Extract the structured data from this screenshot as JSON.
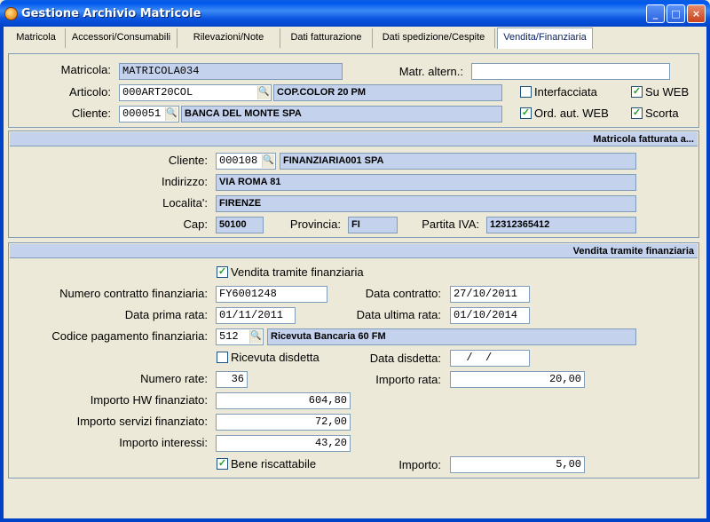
{
  "window": {
    "title": "Gestione Archivio Matricole",
    "min": "_",
    "max": "□",
    "close": "×"
  },
  "tabs": [
    "Matricola",
    "Accessori/Consumabili",
    "Rilevazioni/Note",
    "Dati fatturazione",
    "Dati spedizione/Cespite",
    "Vendita/Finanziaria"
  ],
  "top": {
    "matricola_label": "Matricola:",
    "matricola": "MATRICOLA034",
    "matr_altern_label": "Matr. altern.:",
    "matr_altern": "",
    "articolo_label": "Articolo:",
    "articolo_code": "000ART20COL",
    "articolo_desc": "COP.COLOR 20 PM",
    "cliente_label": "Cliente:",
    "cliente_code": "000051",
    "cliente_desc": "BANCA DEL MONTE SPA",
    "interfacciata_label": "Interfacciata",
    "interfacciata": false,
    "su_web_label": "Su WEB",
    "su_web": true,
    "ord_aut_web_label": "Ord. aut. WEB",
    "ord_aut_web": true,
    "scorta_label": "Scorta",
    "scorta": true
  },
  "fatturata": {
    "header": "Matricola fatturata a...",
    "cliente_label": "Cliente:",
    "cliente_code": "000108",
    "cliente_desc": "FINANZIARIA001 SPA",
    "indirizzo_label": "Indirizzo:",
    "indirizzo": "VIA ROMA 81",
    "localita_label": "Localita':",
    "localita": "FIRENZE",
    "cap_label": "Cap:",
    "cap": "50100",
    "provincia_label": "Provincia:",
    "provincia": "FI",
    "piva_label": "Partita IVA:",
    "piva": "12312365412"
  },
  "finanziaria": {
    "header": "Vendita tramite finanziaria",
    "vendita_label": "Vendita tramite finanziaria",
    "vendita": true,
    "num_contratto_label": "Numero contratto finanziaria:",
    "num_contratto": "FY6001248",
    "data_contratto_label": "Data contratto:",
    "data_contratto": "27/10/2011",
    "data_prima_label": "Data prima rata:",
    "data_prima": "01/11/2011",
    "data_ultima_label": "Data ultima rata:",
    "data_ultima": "01/10/2014",
    "cod_pag_label": "Codice pagamento finanziaria:",
    "cod_pag": "512",
    "cod_pag_desc": "Ricevuta Bancaria 60 FM",
    "ricevuta_label": "Ricevuta disdetta",
    "ricevuta": false,
    "data_disdetta_label": "Data disdetta:",
    "data_disdetta": "  /  /",
    "numero_rate_label": "Numero rate:",
    "numero_rate": "36",
    "importo_rata_label": "Importo rata:",
    "importo_rata": "20,00",
    "hw_label": "Importo HW finanziato:",
    "hw": "604,80",
    "servizi_label": "Importo servizi finanziato:",
    "servizi": "72,00",
    "interessi_label": "Importo interessi:",
    "interessi": "43,20",
    "bene_label": "Bene riscattabile",
    "bene": true,
    "importo_label": "Importo:",
    "importo": "5,00"
  },
  "icons": {
    "lookup": "lookup-icon",
    "check": "✓"
  }
}
